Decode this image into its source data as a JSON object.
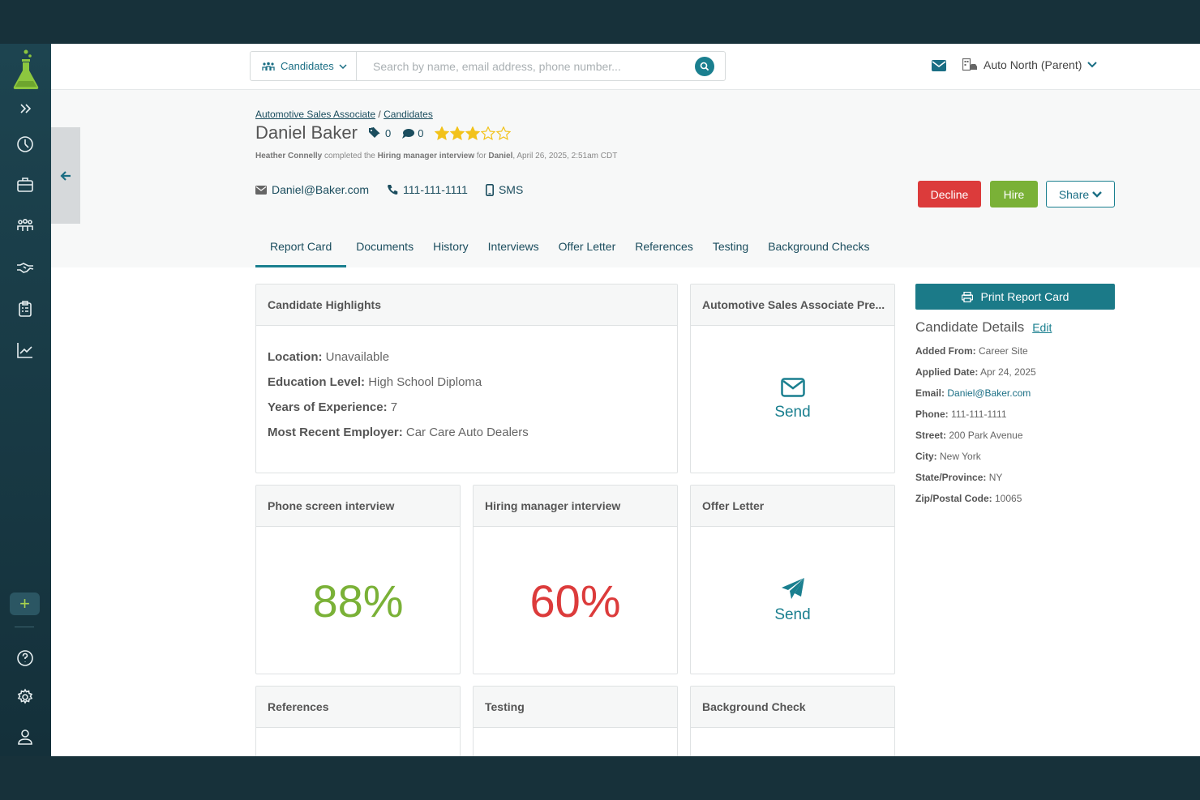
{
  "topbar": {
    "search_scope": "Candidates",
    "search_placeholder": "Search by name, email address, phone number...",
    "organization": "Auto North (Parent)"
  },
  "breadcrumb": {
    "job": "Automotive Sales Associate",
    "separator": "/",
    "section": "Candidates"
  },
  "candidate": {
    "name": "Daniel Baker",
    "tags_count": "0",
    "comments_count": "0",
    "rating": 3,
    "rating_max": 5,
    "activity": {
      "actor": "Heather Connelly",
      "verb": "completed the",
      "action": "Hiring manager interview",
      "for": "for",
      "subject": "Daniel",
      "timestamp": ",  April 26, 2025, 2:51am CDT"
    },
    "email": "Daniel@Baker.com",
    "phone": "111-111-1111",
    "sms": "SMS"
  },
  "actions": {
    "decline": "Decline",
    "hire": "Hire",
    "share": "Share"
  },
  "tabs": [
    "Report Card",
    "Documents",
    "History",
    "Interviews",
    "Offer Letter",
    "References",
    "Testing",
    "Background Checks"
  ],
  "highlights": {
    "title": "Candidate Highlights",
    "items": [
      {
        "label": "Location:",
        "value": " Unavailable"
      },
      {
        "label": "Education Level:",
        "value": " High School Diploma"
      },
      {
        "label": "Years of Experience:",
        "value": " 7"
      },
      {
        "label": "Most Recent Employer:",
        "value": " Car Care Auto Dealers"
      }
    ]
  },
  "cards": {
    "prescreen": {
      "title": "Automotive Sales Associate Pre...",
      "action": "Send"
    },
    "phone_screen": {
      "title": "Phone screen interview",
      "score": "88%",
      "color": "#7ab137"
    },
    "hiring_manager": {
      "title": "Hiring manager interview",
      "score": "60%",
      "color": "#dc3b3b"
    },
    "offer_letter": {
      "title": "Offer Letter",
      "action": "Send"
    },
    "references": {
      "title": "References"
    },
    "testing": {
      "title": "Testing"
    },
    "background": {
      "title": "Background Check"
    }
  },
  "print_button": "Print Report Card",
  "details": {
    "title": "Candidate Details",
    "edit": "Edit",
    "rows": [
      {
        "label": "Added From:",
        "value": " Career Site"
      },
      {
        "label": "Applied Date:",
        "value": " Apr 24, 2025"
      },
      {
        "label": "Email:",
        "value": " Daniel@Baker.com",
        "link": true
      },
      {
        "label": "Phone:",
        "value": " 111-111-1111"
      },
      {
        "label": "Street:",
        "value": " 200 Park Avenue"
      },
      {
        "label": "City:",
        "value": " New York"
      },
      {
        "label": "State/Province:",
        "value": " NY"
      },
      {
        "label": "Zip/Postal Code:",
        "value": " 10065"
      }
    ]
  },
  "colors": {
    "teal": "#1a7f8f",
    "green": "#7ab137",
    "red": "#dc3b3b",
    "sidebar": "#17313a",
    "star": "#f2c21a"
  }
}
